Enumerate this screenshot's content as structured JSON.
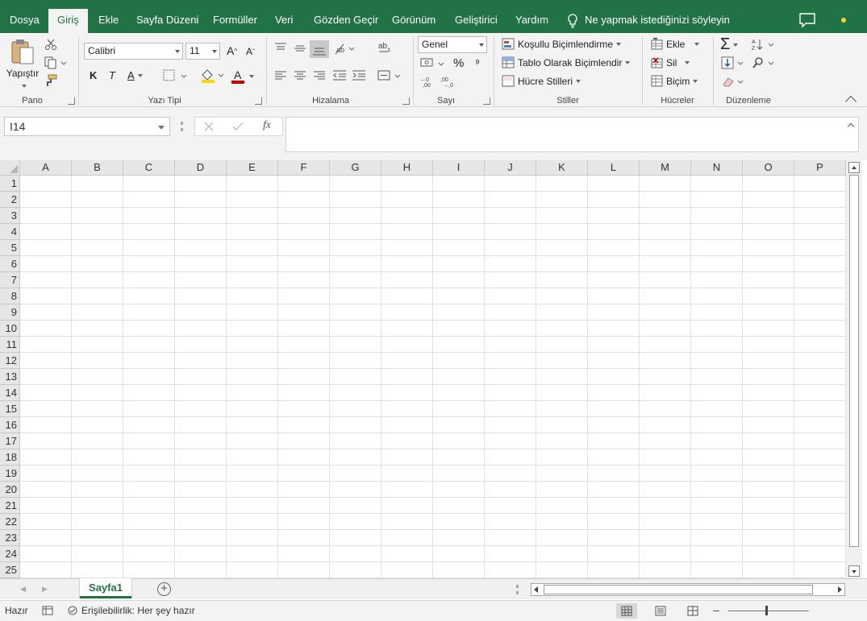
{
  "tabs": [
    {
      "label": "Dosya",
      "active": false
    },
    {
      "label": "Giriş",
      "active": true
    },
    {
      "label": "Ekle",
      "active": false
    },
    {
      "label": "Sayfa Düzeni",
      "active": false
    },
    {
      "label": "Formüller",
      "active": false
    },
    {
      "label": "Veri",
      "active": false
    },
    {
      "label": "Gözden Geçir",
      "active": false
    },
    {
      "label": "Görünüm",
      "active": false
    },
    {
      "label": "Geliştirici",
      "active": false
    },
    {
      "label": "Yardım",
      "active": false
    }
  ],
  "tell_me": "Ne yapmak istediğinizi söyleyin",
  "ribbon": {
    "clipboard": {
      "paste_label": "Yapıştır",
      "group_label": "Pano"
    },
    "font": {
      "name": "Calibri",
      "size": "11",
      "bold": "K",
      "italic": "T",
      "underline": "A",
      "group_label": "Yazı Tipi"
    },
    "alignment": {
      "group_label": "Hizalama"
    },
    "number": {
      "format": "Genel",
      "percent": "%",
      "comma": "⁹",
      "group_label": "Sayı"
    },
    "styles": {
      "conditional": "Koşullu Biçimlendirme",
      "as_table": "Tablo Olarak Biçimlendir",
      "cell_styles": "Hücre Stilleri",
      "group_label": "Stiller"
    },
    "cells": {
      "insert": "Ekle",
      "delete": "Sil",
      "format": "Biçim",
      "group_label": "Hücreler"
    },
    "editing": {
      "group_label": "Düzenleme"
    }
  },
  "formula_bar": {
    "name_box": "I14",
    "fx": "fx",
    "value": ""
  },
  "grid": {
    "columns": [
      "A",
      "B",
      "C",
      "D",
      "E",
      "F",
      "G",
      "H",
      "I",
      "J",
      "K",
      "L",
      "M",
      "N",
      "O",
      "P"
    ],
    "rows": [
      "1",
      "2",
      "3",
      "4",
      "5",
      "6",
      "7",
      "8",
      "9",
      "10",
      "11",
      "12",
      "13",
      "14",
      "15",
      "16",
      "17",
      "18",
      "19",
      "20",
      "21",
      "22",
      "23",
      "24",
      "25"
    ]
  },
  "sheets": [
    {
      "label": "Sayfa1",
      "active": true
    }
  ],
  "status": {
    "ready": "Hazır",
    "accessibility": "Erişilebilirlik: Her şey hazır"
  },
  "colors": {
    "brand": "#217346",
    "font_color_bar": "#c00000",
    "fill_color_bar": "#ffd700"
  }
}
